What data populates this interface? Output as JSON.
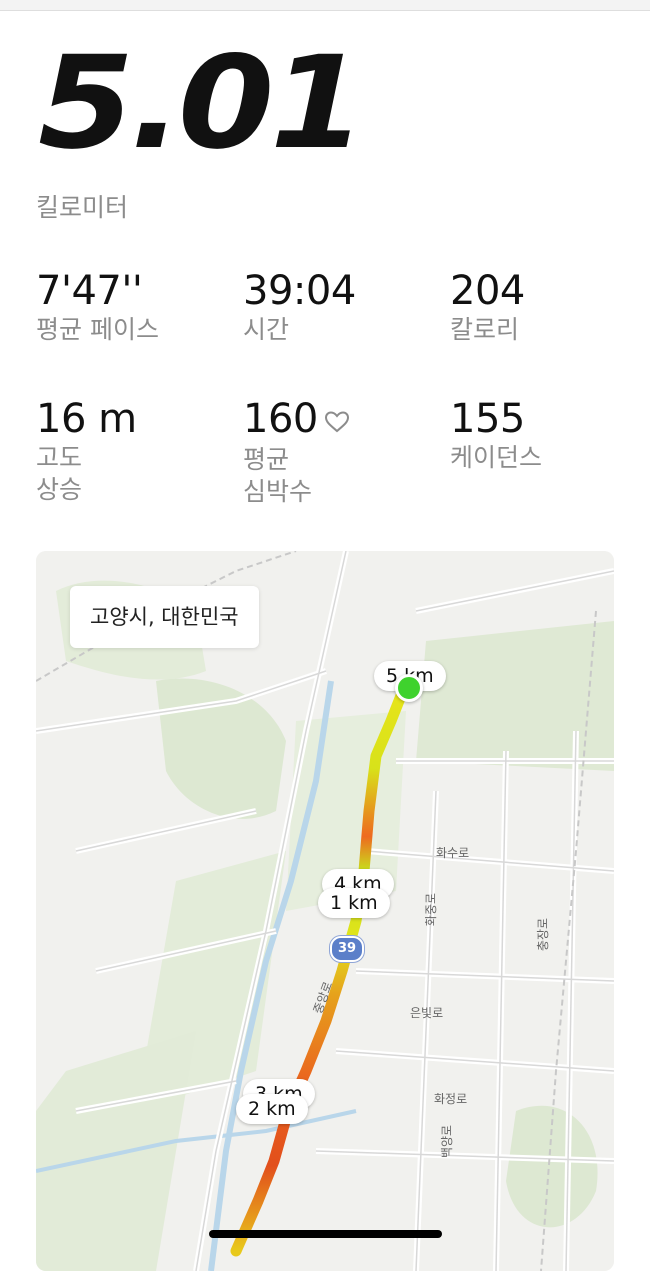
{
  "summary": {
    "distance": "5.01",
    "unit": "킬로미터"
  },
  "stats": [
    {
      "value": "7'47''",
      "label": "평균 페이스"
    },
    {
      "value": "39:04",
      "label": "시간"
    },
    {
      "value": "204",
      "label": "칼로리"
    },
    {
      "value": "16 m",
      "label": "고도\n상승"
    },
    {
      "value": "160",
      "label": "평균\n심박수",
      "icon": "heart-outline-icon"
    },
    {
      "value": "155",
      "label": "케이던스"
    }
  ],
  "map": {
    "location": "고양시, 대한민국",
    "markers": [
      "5 km",
      "4 km",
      "1 km",
      "3 km",
      "2 km"
    ],
    "route_shield": "39",
    "road_labels": [
      "화수로",
      "화중로",
      "충장로",
      "은빛로",
      "화정로",
      "백양로",
      "중앙로"
    ],
    "colors": {
      "route_fast": "#e8e41a",
      "route_slow": "#e23a1c",
      "end_dot": "#3fd22d"
    }
  }
}
